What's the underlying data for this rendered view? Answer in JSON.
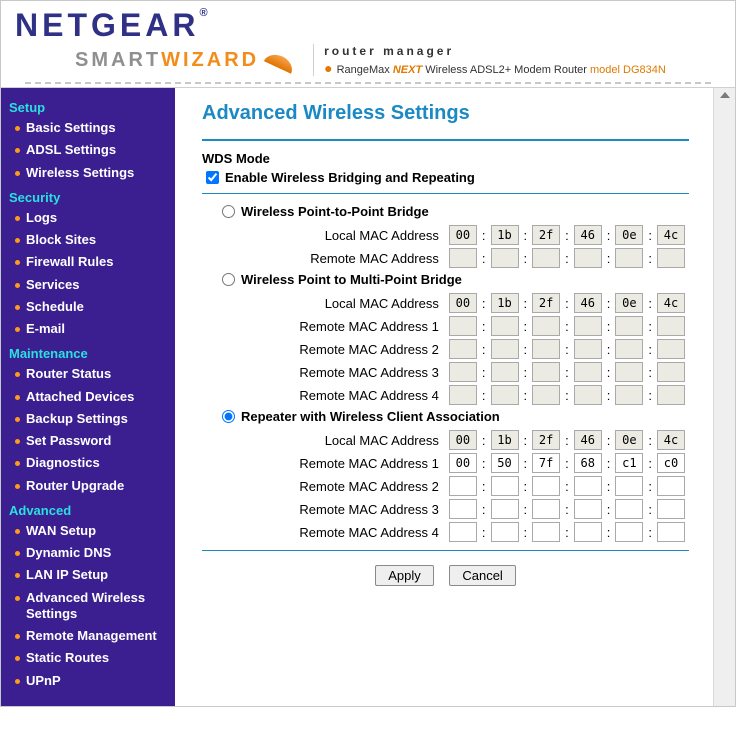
{
  "brand": {
    "name": "NETGEAR",
    "smartwizard_gray": "SMART",
    "smartwizard_orange": "WIZARD",
    "router_manager": "router manager",
    "subline_pre": "RangeMax",
    "subline_next": "NEXT",
    "subline_rest": "Wireless ADSL2+ Modem Router",
    "subline_model_label": "model",
    "subline_model": "DG834N"
  },
  "sidebar": {
    "sections": [
      {
        "title": "Setup",
        "items": [
          "Basic Settings",
          "ADSL Settings",
          "Wireless Settings"
        ]
      },
      {
        "title": "Security",
        "items": [
          "Logs",
          "Block Sites",
          "Firewall Rules",
          "Services",
          "Schedule",
          "E-mail"
        ]
      },
      {
        "title": "Maintenance",
        "items": [
          "Router Status",
          "Attached Devices",
          "Backup Settings",
          "Set Password",
          "Diagnostics",
          "Router Upgrade"
        ]
      },
      {
        "title": "Advanced",
        "items": [
          "WAN Setup",
          "Dynamic DNS",
          "LAN IP Setup",
          "Advanced Wireless Settings",
          "Remote Management",
          "Static Routes",
          "UPnP"
        ]
      }
    ]
  },
  "page": {
    "title": "Advanced Wireless Settings",
    "wds_mode_label": "WDS Mode",
    "enable_label": "Enable Wireless Bridging and Repeating",
    "enable_checked": true,
    "options": {
      "ptp": {
        "label": "Wireless Point-to-Point Bridge",
        "selected": false,
        "local_label": "Local MAC Address",
        "local_mac": [
          "00",
          "1b",
          "2f",
          "46",
          "0e",
          "4c"
        ],
        "remotes": [
          {
            "label": "Remote MAC Address",
            "mac": [
              "",
              "",
              "",
              "",
              "",
              ""
            ]
          }
        ]
      },
      "ptmp": {
        "label": "Wireless Point to Multi-Point Bridge",
        "selected": false,
        "local_label": "Local MAC Address",
        "local_mac": [
          "00",
          "1b",
          "2f",
          "46",
          "0e",
          "4c"
        ],
        "remotes": [
          {
            "label": "Remote MAC Address 1",
            "mac": [
              "",
              "",
              "",
              "",
              "",
              ""
            ]
          },
          {
            "label": "Remote MAC Address 2",
            "mac": [
              "",
              "",
              "",
              "",
              "",
              ""
            ]
          },
          {
            "label": "Remote MAC Address 3",
            "mac": [
              "",
              "",
              "",
              "",
              "",
              ""
            ]
          },
          {
            "label": "Remote MAC Address 4",
            "mac": [
              "",
              "",
              "",
              "",
              "",
              ""
            ]
          }
        ]
      },
      "rep": {
        "label": "Repeater with Wireless Client Association",
        "selected": true,
        "local_label": "Local MAC Address",
        "local_mac": [
          "00",
          "1b",
          "2f",
          "46",
          "0e",
          "4c"
        ],
        "remotes": [
          {
            "label": "Remote MAC Address 1",
            "mac": [
              "00",
              "50",
              "7f",
              "68",
              "c1",
              "c0"
            ]
          },
          {
            "label": "Remote MAC Address 2",
            "mac": [
              "",
              "",
              "",
              "",
              "",
              ""
            ]
          },
          {
            "label": "Remote MAC Address 3",
            "mac": [
              "",
              "",
              "",
              "",
              "",
              ""
            ]
          },
          {
            "label": "Remote MAC Address 4",
            "mac": [
              "",
              "",
              "",
              "",
              "",
              ""
            ]
          }
        ]
      }
    },
    "apply_label": "Apply",
    "cancel_label": "Cancel"
  }
}
